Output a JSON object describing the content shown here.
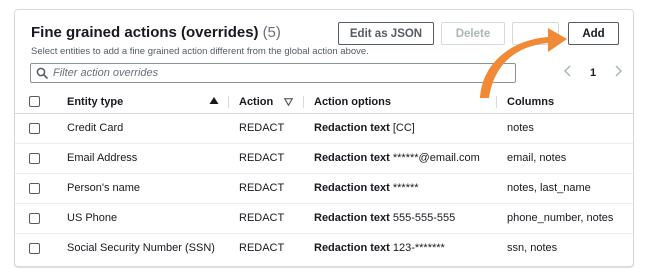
{
  "panel": {
    "title": "Fine grained actions (overrides)",
    "count": "(5)",
    "subtitle": "Select entities to add a fine grained action different from the global action above.",
    "buttons": {
      "edit_json": "Edit as JSON",
      "delete": "Delete",
      "add": "Add"
    },
    "search": {
      "placeholder": "Filter action overrides"
    },
    "pagination": {
      "current_page": "1"
    }
  },
  "table": {
    "headers": {
      "entity": "Entity type",
      "action": "Action",
      "options": "Action options",
      "columns": "Columns"
    },
    "rows": [
      {
        "entity": "Credit Card",
        "action": "REDACT",
        "option_label": "Redaction text",
        "option_value": "[CC]",
        "columns": "notes"
      },
      {
        "entity": "Email Address",
        "action": "REDACT",
        "option_label": "Redaction text",
        "option_value": "******@email.com",
        "columns": "email, notes"
      },
      {
        "entity": "Person's name",
        "action": "REDACT",
        "option_label": "Redaction text",
        "option_value": "******",
        "columns": "notes, last_name"
      },
      {
        "entity": "US Phone",
        "action": "REDACT",
        "option_label": "Redaction text",
        "option_value": "555-555-555",
        "columns": "phone_number, notes"
      },
      {
        "entity": "Social Security Number (SSN)",
        "action": "REDACT",
        "option_label": "Redaction text",
        "option_value": "123-*******",
        "columns": "ssn, notes"
      }
    ]
  },
  "colors": {
    "arrow": "#f08a36",
    "border": "#d5dbdb",
    "text": "#16191f",
    "muted": "#545b64",
    "disabled": "#aab7b8"
  },
  "icons": [
    "search-icon",
    "chevron-left-icon",
    "chevron-right-icon",
    "sort-ascending-icon",
    "filter-icon",
    "annotation-arrow-icon"
  ]
}
